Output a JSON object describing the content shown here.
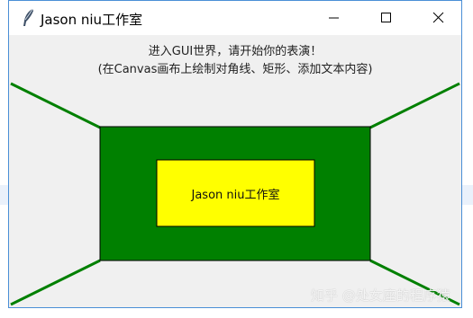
{
  "window": {
    "title": "Jason niu工作室",
    "app_icon": "feather-icon",
    "controls": {
      "minimize_icon": "minimize-icon",
      "maximize_icon": "maximize-icon",
      "close_icon": "close-icon"
    }
  },
  "canvas": {
    "line1": "进入GUI世界，请开始你的表演！",
    "line2": "(在Canvas画布上绘制对角线、矩形、添加文本内容)",
    "center_text": "Jason niu工作室"
  },
  "colors": {
    "outer_rect_fill": "#008000",
    "inner_rect_fill": "#ffff00",
    "diagonal_lines": "#008000",
    "canvas_bg": "#f0f0f0",
    "window_border": "#4a8fd6"
  },
  "watermark": "知乎 @处女座的程序猿"
}
